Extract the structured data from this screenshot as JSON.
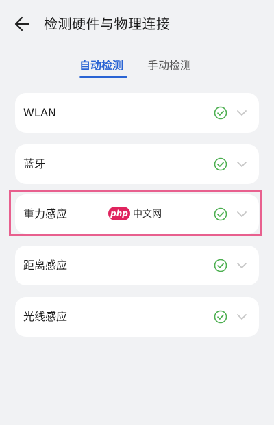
{
  "header": {
    "back_icon": "arrow-left-icon",
    "title": "检测硬件与物理连接"
  },
  "tabs": [
    {
      "label": "自动检测",
      "active": true
    },
    {
      "label": "手动检测",
      "active": false
    }
  ],
  "items": [
    {
      "label": "WLAN",
      "status_icon": "check-circle-icon",
      "expand_icon": "chevron-down-icon"
    },
    {
      "label": "蓝牙",
      "status_icon": "check-circle-icon",
      "expand_icon": "chevron-down-icon"
    },
    {
      "label": "重力感应",
      "status_icon": "check-circle-icon",
      "expand_icon": "chevron-down-icon"
    },
    {
      "label": "距离感应",
      "status_icon": "check-circle-icon",
      "expand_icon": "chevron-down-icon"
    },
    {
      "label": "光线感应",
      "status_icon": "check-circle-icon",
      "expand_icon": "chevron-down-icon"
    }
  ],
  "watermark": {
    "logo_text": "php",
    "text": "中文网"
  },
  "colors": {
    "accent": "#2a64d4",
    "success": "#4caf50",
    "highlight": "#e8608e",
    "background": "#f1f2f4",
    "card": "#ffffff"
  }
}
